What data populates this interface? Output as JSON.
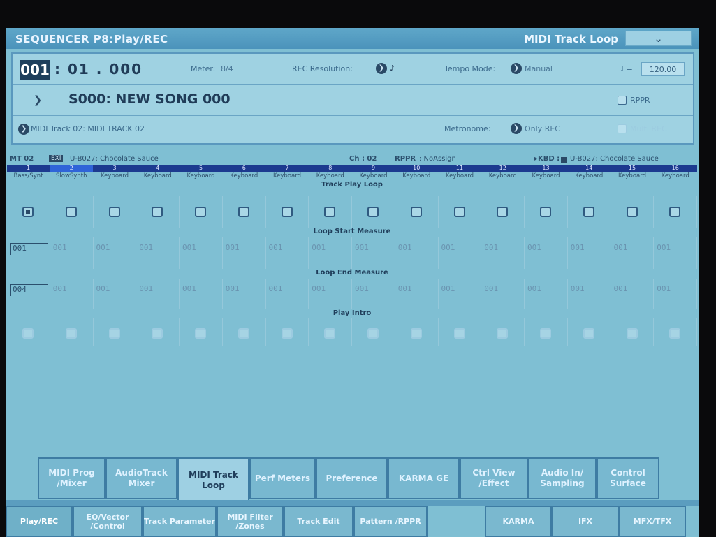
{
  "header": {
    "title": "SEQUENCER P8:Play/REC",
    "page_label": "MIDI Track Loop",
    "dropdown_icon": "chevron-down-icon"
  },
  "position": {
    "measure": "001",
    "beat": ": 01",
    "tick": ". 000"
  },
  "meter": {
    "label": "Meter:",
    "value": "8/4"
  },
  "rec_resolution": {
    "label": "REC Resolution:",
    "value": "♪"
  },
  "tempo_mode": {
    "label": "Tempo Mode:",
    "value": "Manual"
  },
  "tempo": {
    "label": "♩ =",
    "value": "120.00"
  },
  "song": {
    "name": "S000: NEW SONG 000"
  },
  "rppr": {
    "label": "RPPR"
  },
  "track_select": {
    "value": "MIDI Track 02: MIDI TRACK 02"
  },
  "metronome": {
    "label": "Metronome:",
    "value": "Only REC"
  },
  "multi_rec": {
    "label": "Multi REC"
  },
  "mt_bar": {
    "track": "MT 02",
    "bank_tag": "EXi",
    "program": "U-B027: Chocolate Sauce",
    "channel": "Ch : 02",
    "rppr_label": "RPPR",
    "rppr_value": ": NoAssign",
    "kbd": "▸KBD :",
    "kbd_program": "U-B027: Chocolate Sauce"
  },
  "tracks": [
    {
      "num": "1",
      "name": "Bass/Synt",
      "loop": true,
      "start": "001",
      "end": "004"
    },
    {
      "num": "2",
      "name": "SlowSynth",
      "loop": false,
      "start": "001",
      "end": "001"
    },
    {
      "num": "3",
      "name": "Keyboard",
      "loop": false,
      "start": "001",
      "end": "001"
    },
    {
      "num": "4",
      "name": "Keyboard",
      "loop": false,
      "start": "001",
      "end": "001"
    },
    {
      "num": "5",
      "name": "Keyboard",
      "loop": false,
      "start": "001",
      "end": "001"
    },
    {
      "num": "6",
      "name": "Keyboard",
      "loop": false,
      "start": "001",
      "end": "001"
    },
    {
      "num": "7",
      "name": "Keyboard",
      "loop": false,
      "start": "001",
      "end": "001"
    },
    {
      "num": "8",
      "name": "Keyboard",
      "loop": false,
      "start": "001",
      "end": "001"
    },
    {
      "num": "9",
      "name": "Keyboard",
      "loop": false,
      "start": "001",
      "end": "001"
    },
    {
      "num": "10",
      "name": "Keyboard",
      "loop": false,
      "start": "001",
      "end": "001"
    },
    {
      "num": "11",
      "name": "Keyboard",
      "loop": false,
      "start": "001",
      "end": "001"
    },
    {
      "num": "12",
      "name": "Keyboard",
      "loop": false,
      "start": "001",
      "end": "001"
    },
    {
      "num": "13",
      "name": "Keyboard",
      "loop": false,
      "start": "001",
      "end": "001"
    },
    {
      "num": "14",
      "name": "Keyboard",
      "loop": false,
      "start": "001",
      "end": "001"
    },
    {
      "num": "15",
      "name": "Keyboard",
      "loop": false,
      "start": "001",
      "end": "001"
    },
    {
      "num": "16",
      "name": "Keyboard",
      "loop": false,
      "start": "001",
      "end": "001"
    }
  ],
  "sections": {
    "track_play_loop": "Track Play Loop",
    "loop_start": "Loop Start Measure",
    "loop_end": "Loop End Measure",
    "play_intro": "Play Intro"
  },
  "page_tabs": [
    {
      "label": "MIDI Prog /Mixer",
      "active": false
    },
    {
      "label": "AudioTrack Mixer",
      "active": false
    },
    {
      "label": "MIDI Track Loop",
      "active": true
    },
    {
      "label": "Perf Meters",
      "active": false
    },
    {
      "label": "Preference",
      "active": false
    },
    {
      "label": "KARMA GE",
      "active": false
    },
    {
      "label": "Ctrl View /Effect",
      "active": false
    },
    {
      "label": "Audio In/ Sampling",
      "active": false
    },
    {
      "label": "Control Surface",
      "active": false
    }
  ],
  "bottom_tabs": [
    {
      "label": "Play/REC",
      "active": true
    },
    {
      "label": "EQ/Vector /Control",
      "active": false
    },
    {
      "label": "Track Parameter",
      "active": false
    },
    {
      "label": "MIDI Filter /Zones",
      "active": false
    },
    {
      "label": "Track Edit",
      "active": false
    },
    {
      "label": "Pattern /RPPR",
      "active": false
    },
    {
      "label": "KARMA",
      "active": false
    },
    {
      "label": "IFX",
      "active": false
    },
    {
      "label": "MFX/TFX",
      "active": false
    }
  ]
}
